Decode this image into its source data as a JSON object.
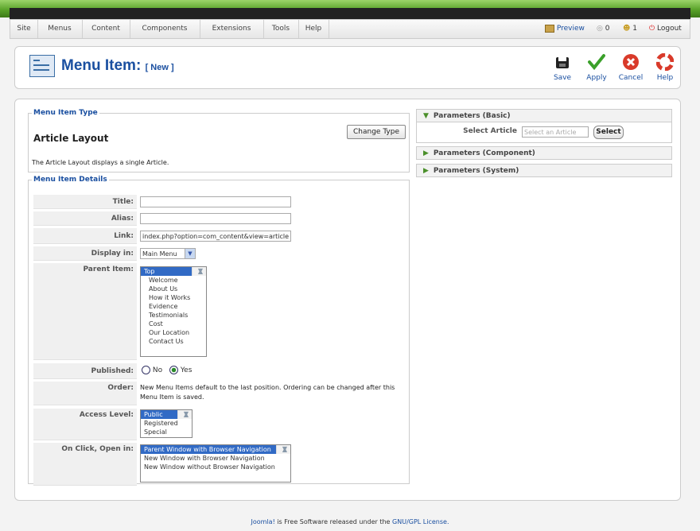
{
  "menu": {
    "items": [
      "Site",
      "Menus",
      "Content",
      "Components",
      "Extensions",
      "Tools",
      "Help"
    ],
    "preview": "Preview",
    "messages_count": "0",
    "users_count": "1",
    "logout": "Logout"
  },
  "header": {
    "title": "Menu Item:",
    "subtitle": "[ New ]",
    "toolbar": {
      "save": "Save",
      "apply": "Apply",
      "cancel": "Cancel",
      "help": "Help"
    }
  },
  "item_type": {
    "legend": "Menu Item Type",
    "name": "Article Layout",
    "change_button": "Change Type",
    "description": "The Article Layout displays a single Article."
  },
  "details": {
    "legend": "Menu Item Details",
    "title_label": "Title:",
    "title_value": "",
    "alias_label": "Alias:",
    "alias_value": "",
    "link_label": "Link:",
    "link_value": "index.php?option=com_content&view=article",
    "display_label": "Display in:",
    "display_value": "Main Menu",
    "parent_label": "Parent Item:",
    "parent_items": [
      "Top",
      "Welcome",
      "About Us",
      "How it Works",
      "Evidence",
      "Testimonials",
      "Cost",
      "Our Location",
      "Contact Us"
    ],
    "published_label": "Published:",
    "published_no": "No",
    "published_yes": "Yes",
    "published_value": "Yes",
    "order_label": "Order:",
    "order_text": "New Menu Items default to the last position. Ordering can be changed after this Menu Item is saved.",
    "access_label": "Access Level:",
    "access_items": [
      "Public",
      "Registered",
      "Special"
    ],
    "onclick_label": "On Click, Open in:",
    "onclick_items": [
      "Parent Window with Browser Navigation",
      "New Window with Browser Navigation",
      "New Window without Browser Navigation"
    ]
  },
  "params": {
    "basic": "Parameters (Basic)",
    "select_article_label": "Select Article",
    "select_article_placeholder": "Select an Article",
    "select_button": "Select",
    "component": "Parameters (Component)",
    "system": "Parameters (System)"
  },
  "footer": {
    "joomla": "Joomla!",
    "text": " is Free Software released under the ",
    "license": "GNU/GPL License."
  }
}
